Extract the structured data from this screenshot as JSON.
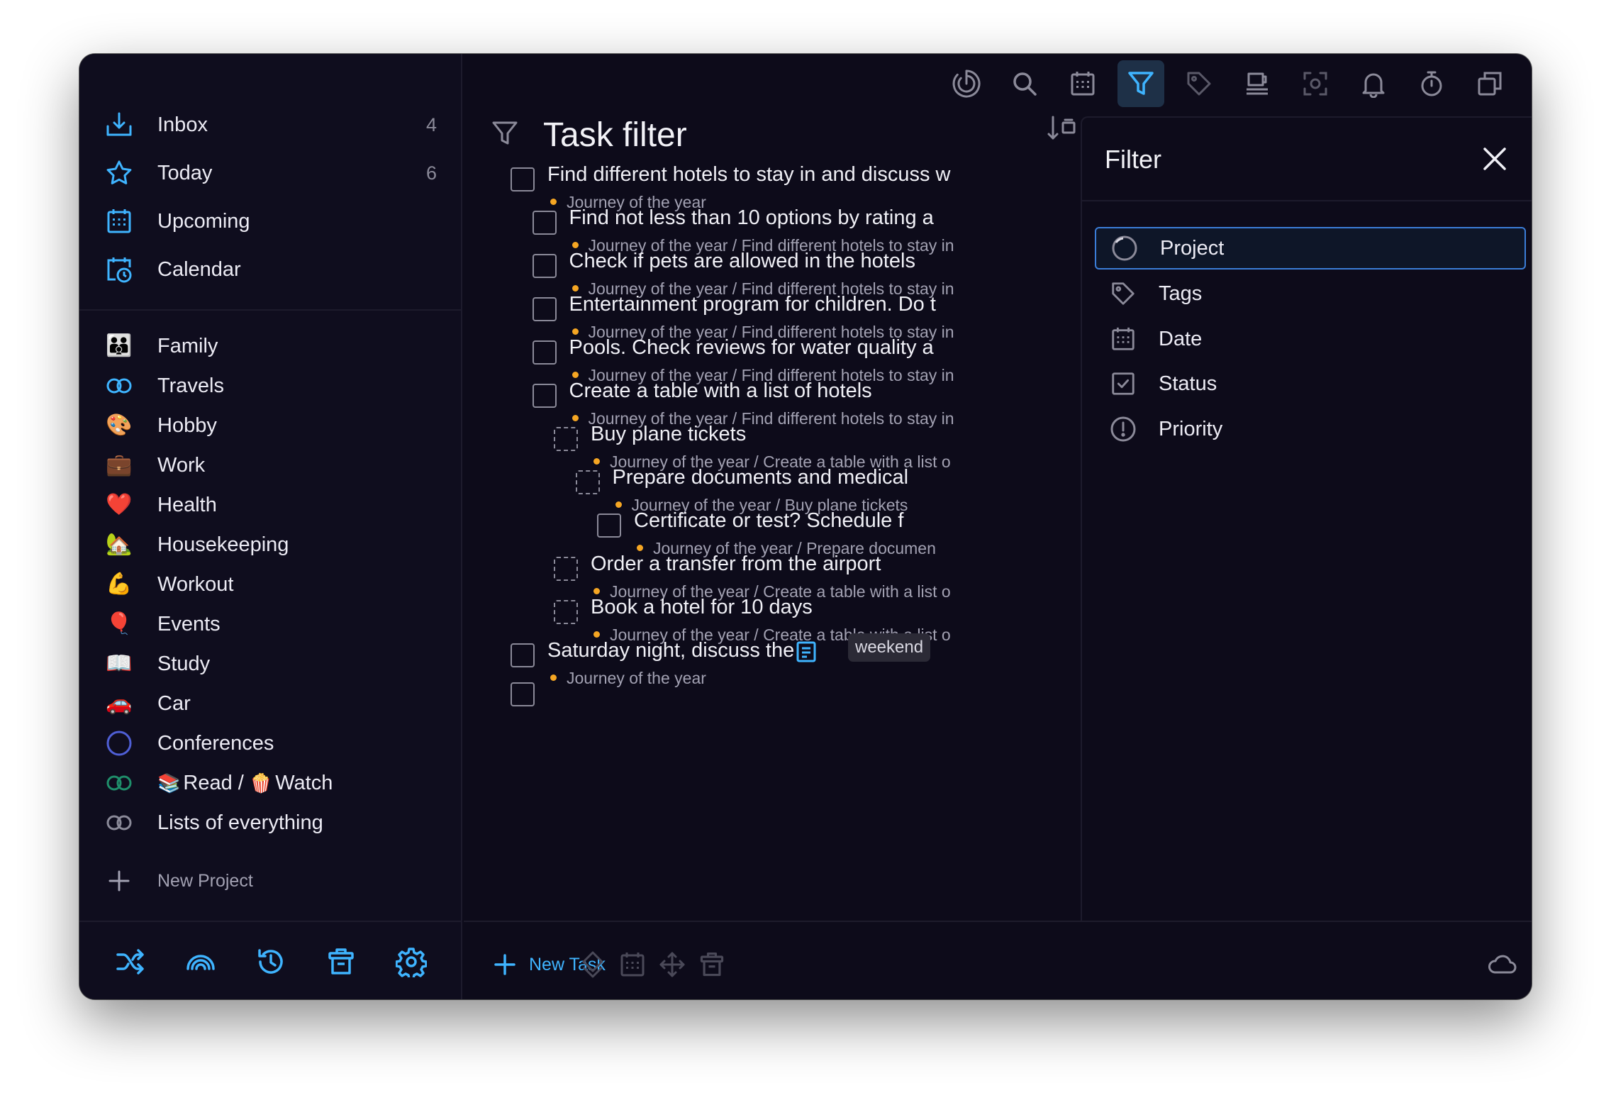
{
  "sidebar": {
    "nav": [
      {
        "label": "Inbox",
        "count": "4",
        "icon": "inbox-icon"
      },
      {
        "label": "Today",
        "count": "6",
        "icon": "star-icon"
      },
      {
        "label": "Upcoming",
        "count": "",
        "icon": "calendar-grid-icon"
      },
      {
        "label": "Calendar",
        "count": "",
        "icon": "calendar-clock-icon"
      }
    ],
    "projects": [
      {
        "label": "Family",
        "icon": "👪"
      },
      {
        "label": "Travels",
        "icon": "infinity-icon"
      },
      {
        "label": "Hobby",
        "icon": "🎨"
      },
      {
        "label": "Work",
        "icon": "💼"
      },
      {
        "label": "Health",
        "icon": "❤️"
      },
      {
        "label": "Housekeeping",
        "icon": "🏡"
      },
      {
        "label": "Workout",
        "icon": "💪"
      },
      {
        "label": "Events",
        "icon": "🎈"
      },
      {
        "label": "Study",
        "icon": "📖"
      },
      {
        "label": "Car",
        "icon": "🚗"
      },
      {
        "label": "Conferences",
        "icon": "ring-icon"
      },
      {
        "label_a": "Read",
        "label_sep": " / ",
        "label_b": "Watch",
        "emoji_a": "📚",
        "emoji_b": "🍿",
        "icon": "infinity-icon"
      },
      {
        "label": "Lists of everything",
        "icon": "infinity-icon"
      }
    ],
    "new_project_label": "New Project"
  },
  "main": {
    "title": "Task filter",
    "tasks": [
      {
        "title": "Find different hotels to stay in and discuss w",
        "path": "Journey of the year",
        "level": 0,
        "dashed": false
      },
      {
        "title": "Find not less than 10 options by rating a",
        "path": "Journey of the year / Find different hotels to stay in",
        "level": 1,
        "dashed": false
      },
      {
        "title": "Check if pets are allowed in the hotels",
        "path": "Journey of the year / Find different hotels to stay in",
        "level": 1,
        "dashed": false
      },
      {
        "title": "Entertainment program for children. Do t",
        "path": "Journey of the year / Find different hotels to stay in",
        "level": 1,
        "dashed": false
      },
      {
        "title": "Pools. Check reviews for water quality a",
        "path": "Journey of the year / Find different hotels to stay in",
        "level": 1,
        "dashed": false
      },
      {
        "title": "Create a table with a list of hotels",
        "path": "Journey of the year / Find different hotels to stay in",
        "level": 1,
        "dashed": false
      },
      {
        "title": "Buy plane tickets",
        "path": "Journey of the year / Create a table with a list o",
        "level": 2,
        "dashed": true
      },
      {
        "title": "Prepare documents and medical",
        "path": "Journey of the year / Buy plane tickets",
        "level": 3,
        "dashed": true
      },
      {
        "title": "Certificate or test? Schedule f",
        "path": "Journey of the year / Prepare documen",
        "level": 4,
        "dashed": false
      },
      {
        "title": "Order a transfer from the airport",
        "path": "Journey of the year / Create a table with a list o",
        "level": 2,
        "dashed": true
      },
      {
        "title": "Book a hotel for 10 days",
        "path": "Journey of the year / Create a table with a list o",
        "level": 2,
        "dashed": true
      },
      {
        "title": "Saturday night, discuss the",
        "path": "Journey of the year",
        "level": 0,
        "dashed": false,
        "tag": "weekend"
      }
    ],
    "new_task_label": "New Task"
  },
  "filter_panel": {
    "title": "Filter",
    "items": [
      {
        "label": "Project",
        "icon": "ring-icon",
        "selected": true
      },
      {
        "label": "Tags",
        "icon": "tag-icon",
        "selected": false
      },
      {
        "label": "Date",
        "icon": "calendar-icon",
        "selected": false
      },
      {
        "label": "Status",
        "icon": "checkbox-icon",
        "selected": false
      },
      {
        "label": "Priority",
        "icon": "exclamation-icon",
        "selected": false
      }
    ]
  },
  "colors": {
    "accent": "#3fb4ff",
    "project_dot": "#f5a623",
    "background": "#0d0b1a"
  }
}
